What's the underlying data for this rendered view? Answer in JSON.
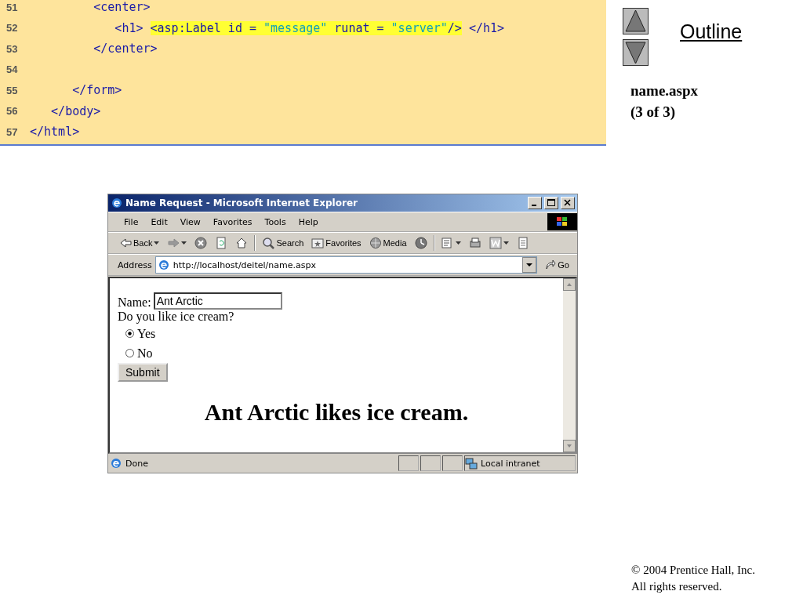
{
  "code": {
    "lines": [
      {
        "number": "51",
        "segments": [
          {
            "text": "         <center>",
            "kind": "tag",
            "highlighted": false
          }
        ]
      },
      {
        "number": "52",
        "segments": [
          {
            "text": "            <h1> ",
            "kind": "tag",
            "highlighted": false
          },
          {
            "text": "<asp:Label id = ",
            "kind": "tag",
            "highlighted": true
          },
          {
            "text": "\"message\"",
            "kind": "string",
            "highlighted": true
          },
          {
            "text": " runat = ",
            "kind": "tag",
            "highlighted": true
          },
          {
            "text": "\"server\"",
            "kind": "string",
            "highlighted": true
          },
          {
            "text": "/>",
            "kind": "tag",
            "highlighted": true
          },
          {
            "text": " </h1>",
            "kind": "tag",
            "highlighted": false
          }
        ]
      },
      {
        "number": "53",
        "segments": [
          {
            "text": "         </center>",
            "kind": "tag",
            "highlighted": false
          }
        ]
      },
      {
        "number": "54"
      },
      {
        "number": "55",
        "segments": [
          {
            "text": "      </form>",
            "kind": "tag",
            "highlighted": false
          }
        ]
      },
      {
        "number": "56",
        "segments": [
          {
            "text": "   </body>",
            "kind": "tag",
            "highlighted": false
          }
        ]
      },
      {
        "number": "57",
        "segments": [
          {
            "text": "</html>",
            "kind": "tag",
            "highlighted": false
          }
        ]
      }
    ]
  },
  "outline": {
    "title": "Outline",
    "file": "name.aspx",
    "part": "(3 of 3)"
  },
  "browser": {
    "title": "Name Request - Microsoft Internet Explorer",
    "menu": [
      "File",
      "Edit",
      "View",
      "Favorites",
      "Tools",
      "Help"
    ],
    "toolbar": [
      {
        "kind": "back",
        "label": "Back",
        "dropdown": true
      },
      {
        "kind": "forward",
        "dropdown": true
      },
      {
        "kind": "stop",
        "dropdown": false
      },
      {
        "kind": "refresh",
        "dropdown": false
      },
      {
        "kind": "home",
        "dropdown": false
      },
      {
        "kind": "separator"
      },
      {
        "kind": "search",
        "label": "Search",
        "dropdown": false
      },
      {
        "kind": "favorites",
        "label": "Favorites",
        "dropdown": false
      },
      {
        "kind": "media",
        "label": "Media",
        "dropdown": false
      },
      {
        "kind": "history",
        "dropdown": false
      },
      {
        "kind": "separator"
      },
      {
        "kind": "mail",
        "dropdown": true
      },
      {
        "kind": "print",
        "dropdown": false
      },
      {
        "kind": "edit",
        "dropdown": true
      },
      {
        "kind": "discuss",
        "dropdown": false
      }
    ],
    "address": {
      "label": "Address",
      "value": "http://localhost/deitel/name.aspx",
      "go": "Go"
    },
    "page": {
      "name_label": "Name:",
      "name_value": "Ant Arctic",
      "question": "Do you like ice cream?",
      "options": [
        {
          "label": "Yes",
          "selected": true
        },
        {
          "label": "No",
          "selected": false
        }
      ],
      "submit": "Submit",
      "message": "Ant Arctic likes ice cream."
    },
    "status_bar": {
      "text": "Done",
      "zone": "Local intranet"
    }
  },
  "footer": {
    "copyright": "© 2004 Prentice Hall, Inc.",
    "rights": "All rights reserved."
  }
}
